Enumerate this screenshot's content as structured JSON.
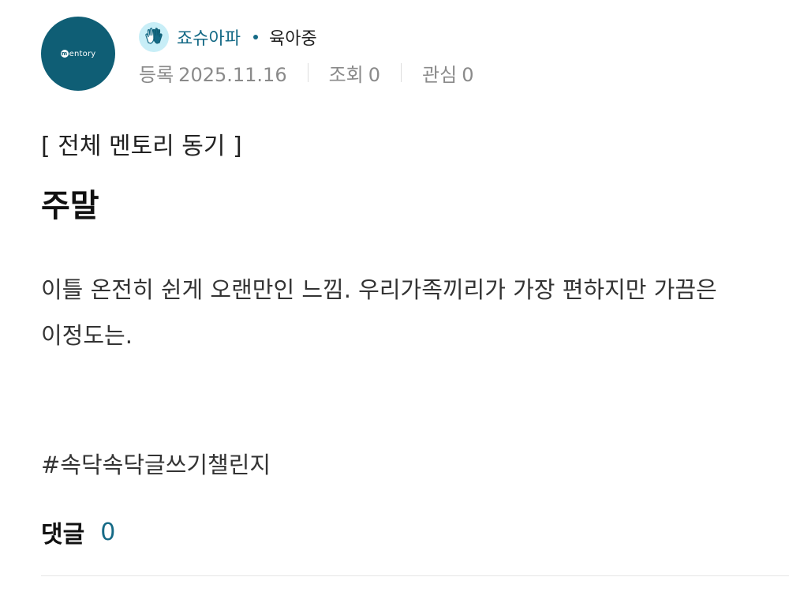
{
  "author": {
    "avatar_logo_text": "entory",
    "badge_icon": "hands-icon",
    "name": "죠슈아파",
    "status": "육아중"
  },
  "stats": {
    "registered_label": "등록",
    "registered_date": "2025.11.16",
    "views_label": "조회",
    "views_count": "0",
    "interest_label": "관심",
    "interest_count": "0"
  },
  "post": {
    "category": "[ 전체 멘토리 동기 ]",
    "title": "주말",
    "body_lines": [
      "이틀 온전히 쉰게 오랜만인 느낌. 우리가족끼리가 가장 편하지만 가끔은",
      "이정도는."
    ],
    "hashtag": "#속닥속닥글쓰기챌린지"
  },
  "comments": {
    "label": "댓글",
    "count": "0"
  },
  "colors": {
    "brand": "#0f5e75",
    "accent": "#156a86",
    "badge_bg": "#c8eef7"
  }
}
